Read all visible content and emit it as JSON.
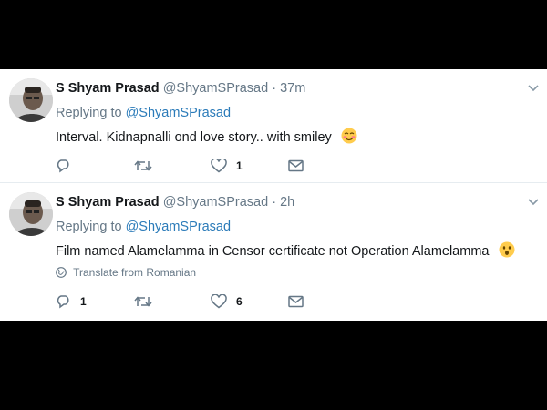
{
  "tweets": [
    {
      "name": "S Shyam Prasad",
      "handle": "@ShyamSPrasad",
      "separator": "·",
      "time": "37m",
      "replying_prefix": "Replying to",
      "replying_to": "@ShyamSPrasad",
      "text": "Interval. Kidnapnalli ond love story.. with smiley",
      "emoji": "blush-emoji",
      "reply_count": "",
      "retweet_count": "",
      "like_count": "1"
    },
    {
      "name": "S Shyam Prasad",
      "handle": "@ShyamSPrasad",
      "separator": "·",
      "time": "2h",
      "replying_prefix": "Replying to",
      "replying_to": "@ShyamSPrasad",
      "text": "Film named Alamelamma in Censor certificate not Operation Alamelamma",
      "emoji": "astonished-emoji",
      "translate": "Translate from Romanian",
      "reply_count": "1",
      "retweet_count": "",
      "like_count": "6"
    }
  ],
  "colors": {
    "background": "#000000",
    "card": "#ffffff",
    "text": "#14171a",
    "muted": "#657786",
    "link": "#2b7bb9",
    "divider": "#e6ecf0"
  }
}
